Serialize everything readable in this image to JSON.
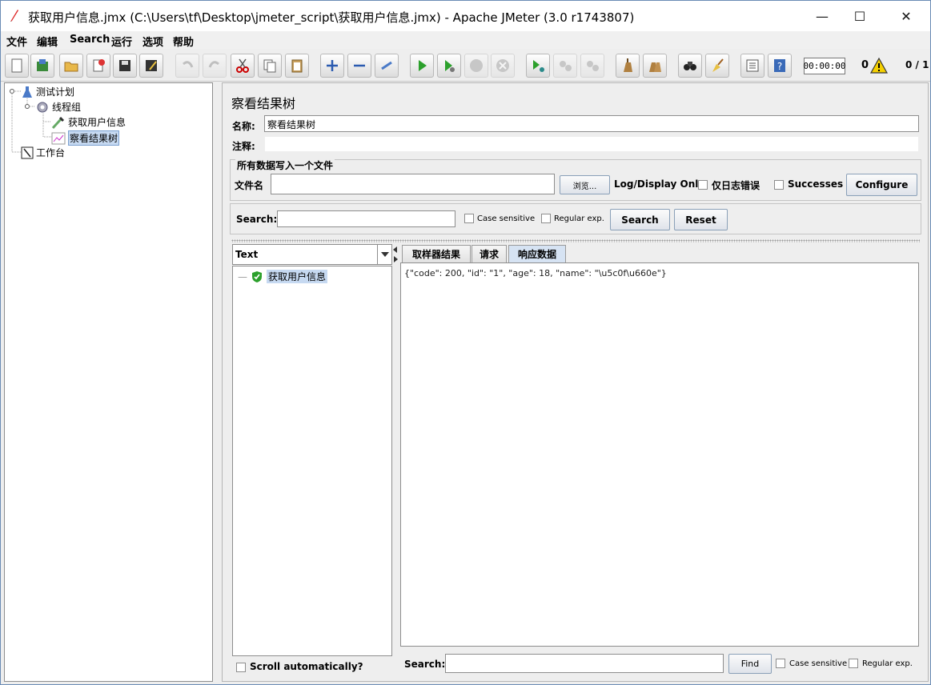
{
  "window": {
    "title": "获取用户信息.jmx (C:\\Users\\tf\\Desktop\\jmeter_script\\获取用户信息.jmx) - Apache JMeter (3.0 r1743807)",
    "minimize_glyph": "—",
    "maximize_glyph": "☐",
    "close_glyph": "✕"
  },
  "menu": [
    "文件",
    "编辑",
    "Search",
    "运行",
    "选项",
    "帮助"
  ],
  "toolbar": {
    "timer": "00:00:00",
    "error_count": "0",
    "threads": "0 / 1",
    "icons": [
      "new-icon",
      "templates-icon",
      "open-icon",
      "close-file-icon",
      "save-icon",
      "save-as-icon",
      "undo-icon",
      "redo-icon",
      "cut-icon",
      "copy-icon",
      "paste-icon",
      "expand-icon",
      "collapse-icon",
      "toggle-icon",
      "start-icon",
      "start-no-pause-icon",
      "stop-icon",
      "shutdown-icon",
      "remote-start-icon",
      "remote-stop-icon",
      "remote-shutdown-icon",
      "clear-icon",
      "clear-all-icon",
      "search-icon",
      "reset-search-icon",
      "function-helper-icon",
      "help-icon"
    ]
  },
  "tree": {
    "items": [
      {
        "label": "测试计划"
      },
      {
        "label": "线程组"
      },
      {
        "label": "获取用户信息"
      },
      {
        "label": "察看结果树"
      },
      {
        "label": "工作台"
      }
    ]
  },
  "panel": {
    "title": "察看结果树",
    "name_label": "名称:",
    "name_value": "察看结果树",
    "comment_label": "注释:",
    "comment_value": "",
    "file_group_title": "所有数据写入一个文件",
    "filename_label": "文件名",
    "filename_value": "",
    "browse_label": "浏览...",
    "log_display_label": "Log/Display Only:",
    "errors_only_label": "仅日志错误",
    "successes_label": "Successes",
    "configure_label": "Configure",
    "search_label": "Search:",
    "search_value": "",
    "case_sensitive_label": "Case sensitive",
    "regex_label": "Regular exp.",
    "search_button": "Search",
    "reset_button": "Reset"
  },
  "results": {
    "renderer": "Text",
    "items": [
      {
        "label": "获取用户信息",
        "status": "success"
      }
    ],
    "scroll_auto_label": "Scroll automatically?"
  },
  "tabs": {
    "items": [
      "取样器结果",
      "请求",
      "响应数据"
    ],
    "active": "响应数据",
    "response_body": "{\"code\": 200, \"id\": \"1\", \"age\": 18, \"name\": \"\\u5c0f\\u660e\"}",
    "bottom_search_label": "Search:",
    "bottom_search_value": "",
    "find_label": "Find",
    "case_sensitive_label": "Case sensitive",
    "regex_label": "Regular exp."
  },
  "colors": {
    "selection": "#c6d9f1",
    "window_border": "#6a8bb5",
    "start_green": "#2ca02c"
  }
}
